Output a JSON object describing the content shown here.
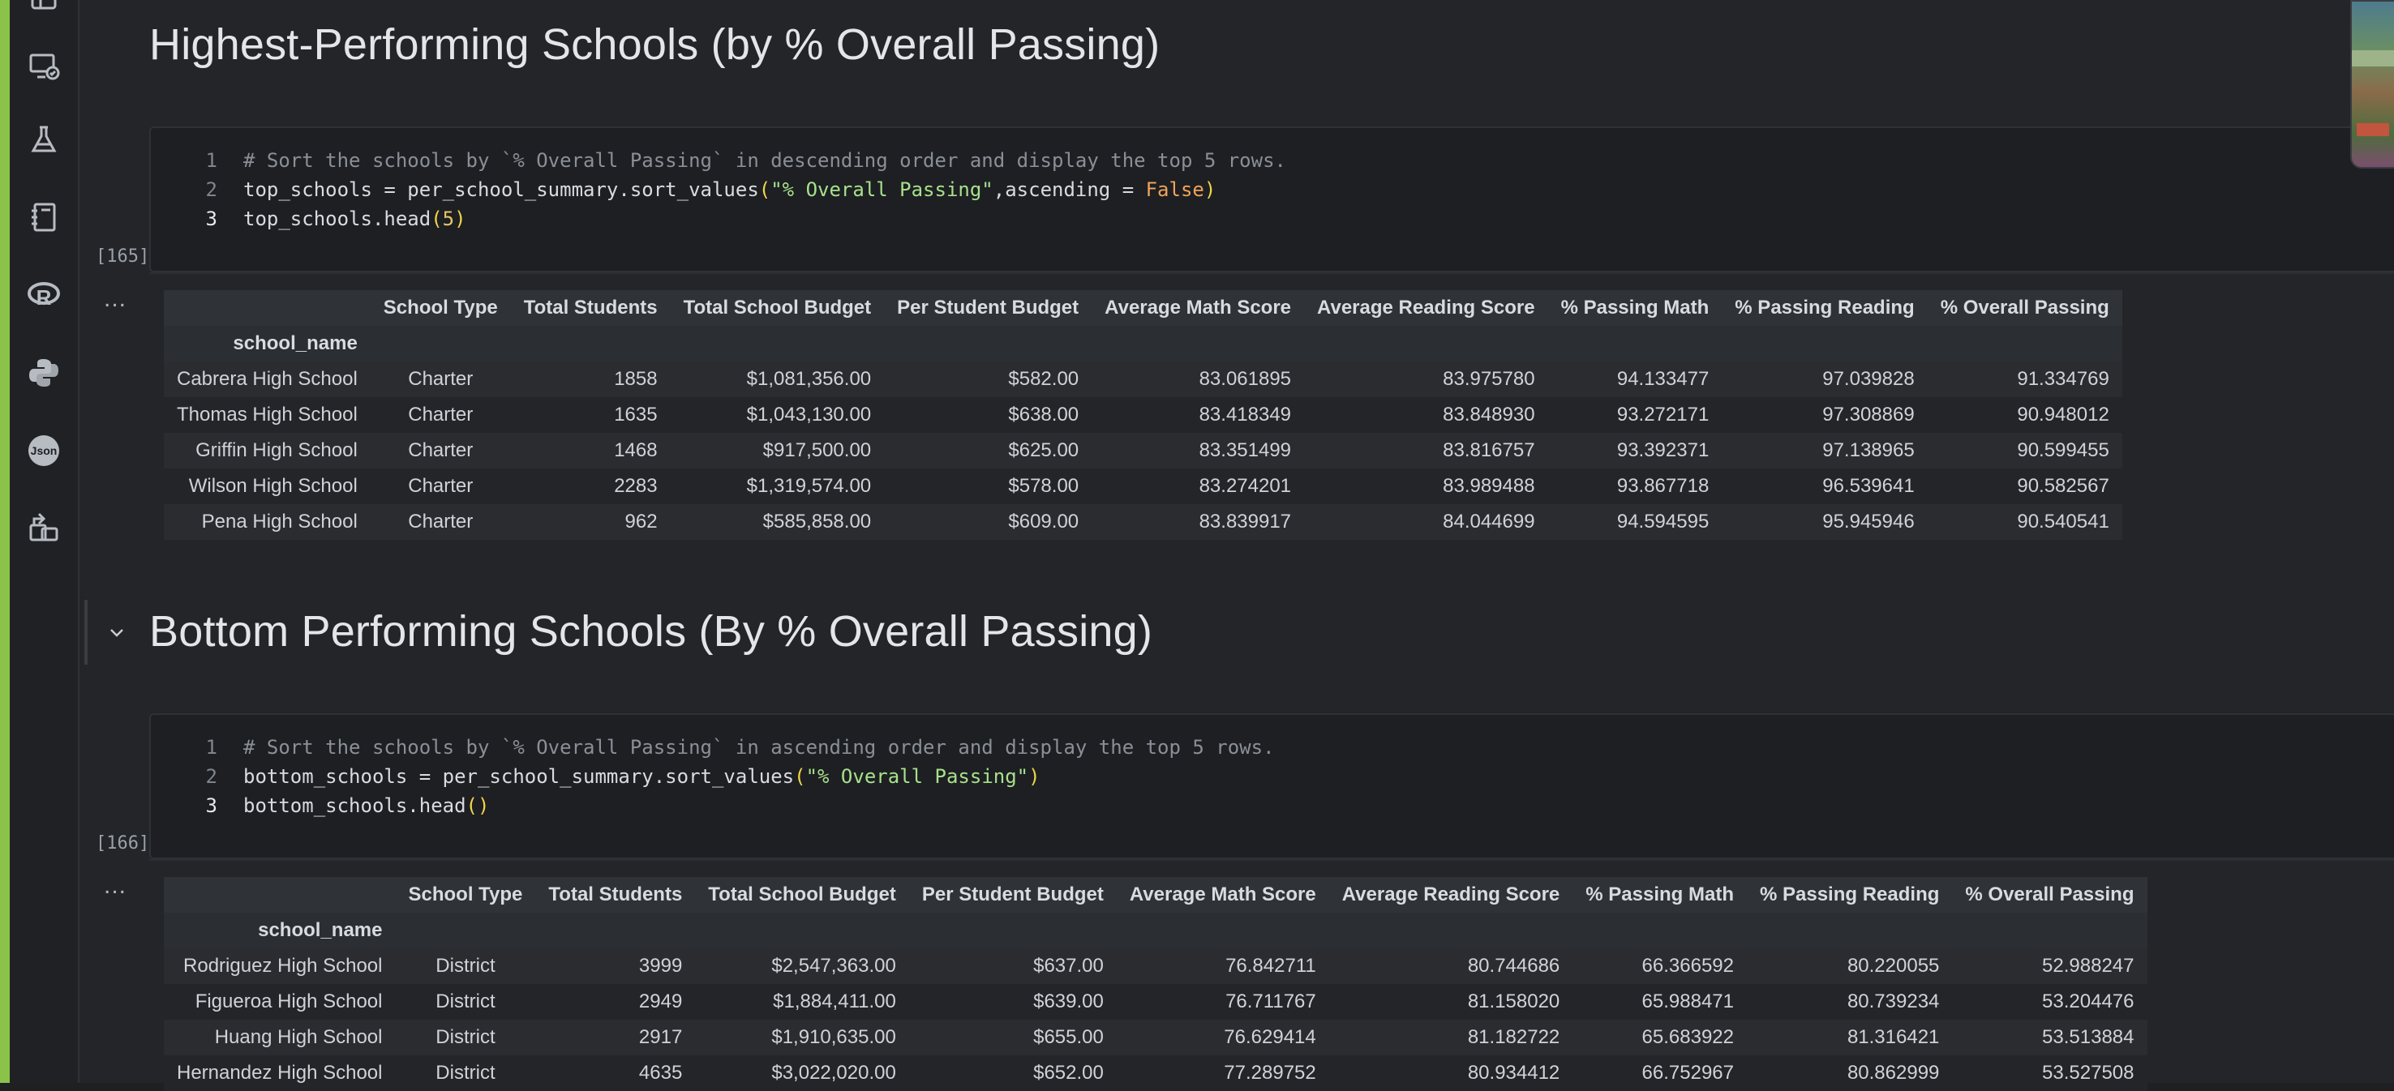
{
  "sections": [
    {
      "heading": "Highest-Performing Schools (by % Overall Passing)",
      "code": {
        "execution_count": "[165]",
        "lines": [
          {
            "number": "1",
            "comment": "# Sort the schools by `% Overall Passing` in descending order and display the top 5 rows."
          },
          {
            "number": "2",
            "pre": "top_schools = per_school_summary.sort_values",
            "open": "(",
            "string": "\"% Overall Passing\"",
            "mid": ",ascending = ",
            "keyword": "False",
            "close": ")"
          },
          {
            "number": "3",
            "pre": "top_schools.head",
            "open": "(",
            "num": "5",
            "close": ")"
          }
        ]
      },
      "output_ellipsis": "...",
      "table": {
        "index_name": "school_name",
        "columns": [
          "School Type",
          "Total Students",
          "Total School Budget",
          "Per Student Budget",
          "Average Math Score",
          "Average Reading Score",
          "% Passing Math",
          "% Passing Reading",
          "% Overall Passing"
        ],
        "rows": [
          {
            "index": "Cabrera High School",
            "cells": [
              "Charter",
              "1858",
              "$1,081,356.00",
              "$582.00",
              "83.061895",
              "83.975780",
              "94.133477",
              "97.039828",
              "91.334769"
            ]
          },
          {
            "index": "Thomas High School",
            "cells": [
              "Charter",
              "1635",
              "$1,043,130.00",
              "$638.00",
              "83.418349",
              "83.848930",
              "93.272171",
              "97.308869",
              "90.948012"
            ]
          },
          {
            "index": "Griffin High School",
            "cells": [
              "Charter",
              "1468",
              "$917,500.00",
              "$625.00",
              "83.351499",
              "83.816757",
              "93.392371",
              "97.138965",
              "90.599455"
            ]
          },
          {
            "index": "Wilson High School",
            "cells": [
              "Charter",
              "2283",
              "$1,319,574.00",
              "$578.00",
              "83.274201",
              "83.989488",
              "93.867718",
              "96.539641",
              "90.582567"
            ]
          },
          {
            "index": "Pena High School",
            "cells": [
              "Charter",
              "962",
              "$585,858.00",
              "$609.00",
              "83.839917",
              "84.044699",
              "94.594595",
              "95.945946",
              "90.540541"
            ]
          }
        ]
      }
    },
    {
      "heading": "Bottom Performing Schools (By % Overall Passing)",
      "code": {
        "execution_count": "[166]",
        "lines": [
          {
            "number": "1",
            "comment": "# Sort the schools by `% Overall Passing` in ascending order and display the top 5 rows."
          },
          {
            "number": "2",
            "pre": "bottom_schools = per_school_summary.sort_values",
            "open": "(",
            "string": "\"% Overall Passing\"",
            "close": ")"
          },
          {
            "number": "3",
            "pre": "bottom_schools.head",
            "open": "(",
            "close": ")"
          }
        ]
      },
      "output_ellipsis": "...",
      "table": {
        "index_name": "school_name",
        "columns": [
          "School Type",
          "Total Students",
          "Total School Budget",
          "Per Student Budget",
          "Average Math Score",
          "Average Reading Score",
          "% Passing Math",
          "% Passing Reading",
          "% Overall Passing"
        ],
        "rows": [
          {
            "index": "Rodriguez High School",
            "cells": [
              "District",
              "3999",
              "$2,547,363.00",
              "$637.00",
              "76.842711",
              "80.744686",
              "66.366592",
              "80.220055",
              "52.988247"
            ]
          },
          {
            "index": "Figueroa High School",
            "cells": [
              "District",
              "2949",
              "$1,884,411.00",
              "$639.00",
              "76.711767",
              "81.158020",
              "65.988471",
              "80.739234",
              "53.204476"
            ]
          },
          {
            "index": "Huang High School",
            "cells": [
              "District",
              "2917",
              "$1,910,635.00",
              "$655.00",
              "76.629414",
              "81.182722",
              "65.683922",
              "81.316421",
              "53.513884"
            ]
          },
          {
            "index": "Hernandez High School",
            "cells": [
              "District",
              "4635",
              "$3,022,020.00",
              "$652.00",
              "77.289752",
              "80.934412",
              "66.752967",
              "80.862999",
              "53.527508"
            ]
          }
        ]
      }
    }
  ],
  "activity_bar": {
    "icons": [
      "remote-explorer-icon",
      "testing-flask-icon",
      "notebook-icon",
      "r-language-icon",
      "python-icon",
      "json-icon",
      "extensions-icon"
    ],
    "json_icon_text": "Json"
  },
  "colors": {
    "accent_edge": "#8bc34a",
    "string": "#a8e08c",
    "keyword": "#f0a35b"
  }
}
